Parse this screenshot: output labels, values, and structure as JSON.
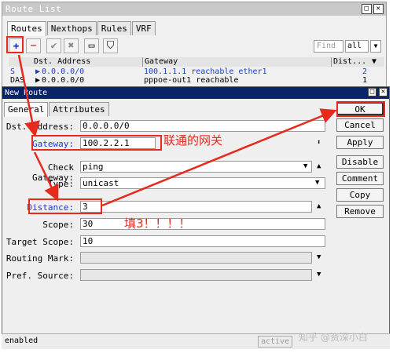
{
  "route_list": {
    "title": "Route List",
    "tabs": [
      "Routes",
      "Nexthops",
      "Rules",
      "VRF"
    ],
    "find_placeholder": "Find",
    "filter_value": "all",
    "columns": [
      "Dst. Address",
      "Gateway",
      "Dist..."
    ],
    "rows": [
      {
        "flag": "S",
        "dst": "0.0.0.0/0",
        "gateway": "100.1.1.1 reachable ether1",
        "dist": "2"
      },
      {
        "flag": "DAS",
        "dst": "0.0.0.0/0",
        "gateway": "pppoe-out1 reachable",
        "dist": "1"
      }
    ]
  },
  "new_route": {
    "title": "New Route",
    "tabs": [
      "General",
      "Attributes"
    ],
    "fields": {
      "dst_label": "Dst. Address:",
      "dst_value": "0.0.0.0/0",
      "gateway_label": "Gateway:",
      "gateway_value": "100.2.2.1",
      "check_label": "Check Gateway:",
      "check_value": "ping",
      "type_label": "Type:",
      "type_value": "unicast",
      "distance_label": "Distance:",
      "distance_value": "3",
      "scope_label": "Scope:",
      "scope_value": "30",
      "target_label": "Target Scope:",
      "target_value": "10",
      "mark_label": "Routing Mark:",
      "pref_label": "Pref. Source:"
    },
    "buttons": [
      "OK",
      "Cancel",
      "Apply",
      "Disable",
      "Comment",
      "Copy",
      "Remove"
    ],
    "status_left": "enabled",
    "status_right": "active"
  },
  "annotations": {
    "gateway_note": "联通的网关",
    "distance_note": "填3！！！！",
    "watermark": "知乎 @资深小白"
  },
  "colors": {
    "annotation": "#e52a1e",
    "titlebar_active": "#0a246a",
    "link_blue": "#1a3cc8"
  }
}
